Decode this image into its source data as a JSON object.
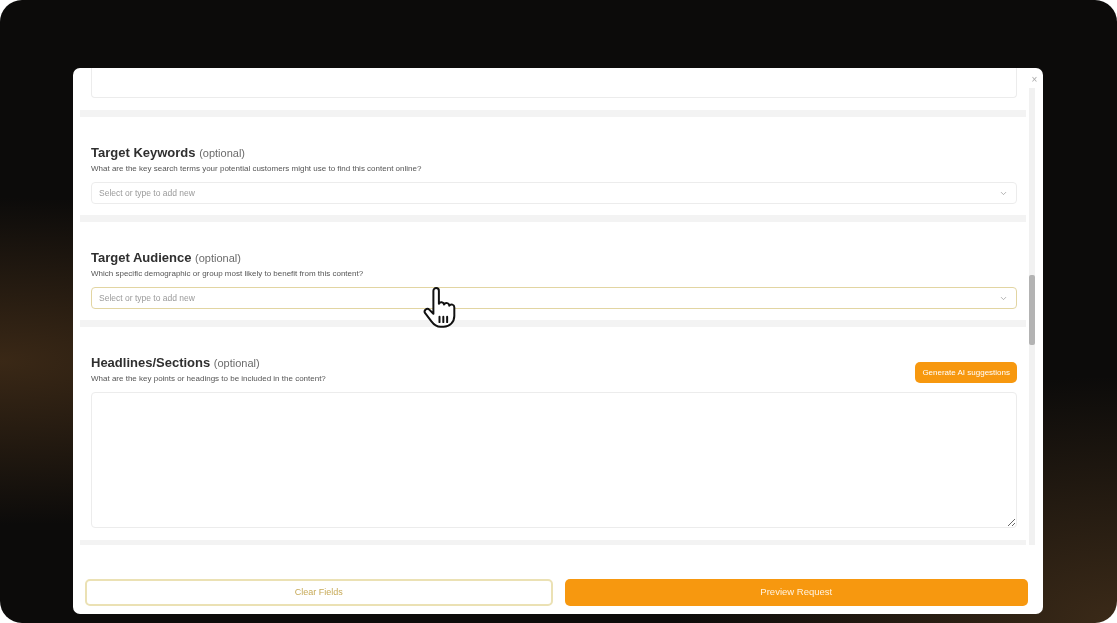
{
  "modal": {
    "close_label": "×"
  },
  "sections": [
    {
      "kind": "select",
      "title": "Target Keywords",
      "note": "(optional)",
      "description": "What are the key search terms your potential customers might use to find this content online?",
      "placeholder": "Select or type to add new",
      "highlighted": false
    },
    {
      "kind": "select",
      "title": "Target Audience",
      "note": "(optional)",
      "description": "Which specific demographic or group most likely to benefit from this content?",
      "placeholder": "Select or type to add new",
      "highlighted": true
    },
    {
      "kind": "textarea",
      "title": "Headlines/Sections",
      "note": "(optional)",
      "description": "What are the key points or headings to be included in the content?",
      "action": "Generate AI suggestions"
    }
  ],
  "footer": {
    "buttons": [
      {
        "kind": "outline",
        "label": "Clear Fields"
      },
      {
        "kind": "primary",
        "label": "Preview Request"
      }
    ]
  }
}
